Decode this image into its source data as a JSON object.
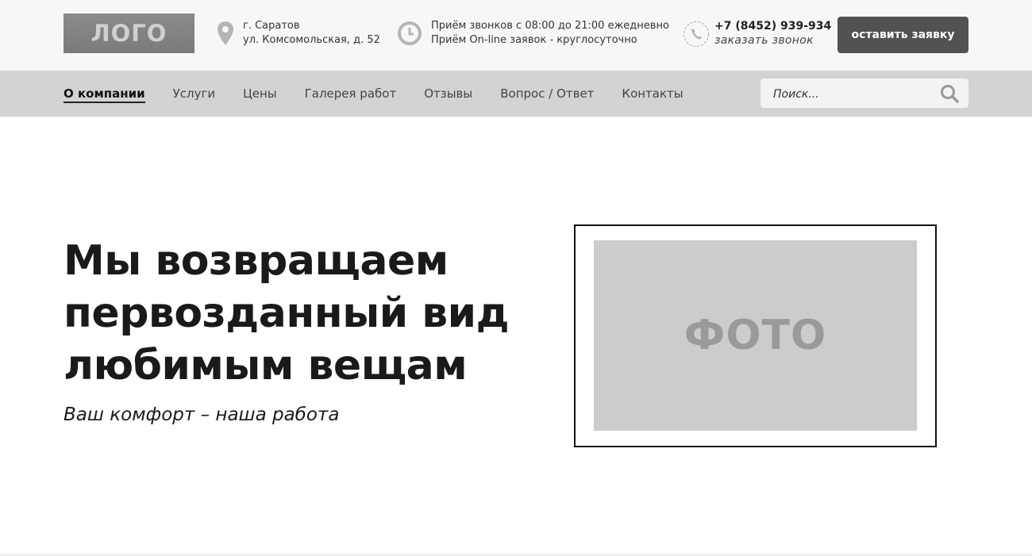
{
  "header": {
    "logo_text": "ЛОГО",
    "address": {
      "icon": "map-pin-icon",
      "city": "г. Саратов",
      "street": "ул. Комсомольская, д. 52"
    },
    "hours": {
      "icon": "clock-icon",
      "calls": "Приём звонков с 08:00 до 21:00 ежедневно",
      "online": "Приём On-line  заявок - круглосуточно"
    },
    "phone": {
      "icon": "phone-icon",
      "number": "+7 (8452) 939-934",
      "callback_label": "заказать звонок"
    },
    "cta_label": "оставить заявку"
  },
  "nav": {
    "items": [
      {
        "label": "О компании",
        "active": true
      },
      {
        "label": "Услуги"
      },
      {
        "label": "Цены"
      },
      {
        "label": "Галерея работ"
      },
      {
        "label": "Отзывы"
      },
      {
        "label": "Вопрос / Ответ"
      },
      {
        "label": "Контакты"
      }
    ]
  },
  "search": {
    "placeholder": "Поиск...",
    "icon": "search-icon"
  },
  "hero": {
    "title": "Мы возвращаем первозданный вид любимым вещам",
    "subtitle": "Ваш комфорт – наша работа",
    "photo_label": "ФОТО"
  },
  "colors": {
    "topbar_bg": "#f7f7f7",
    "navbar_bg": "#d3d3d3",
    "cta_bg": "#525252",
    "placeholder_bg": "#cccccc"
  }
}
